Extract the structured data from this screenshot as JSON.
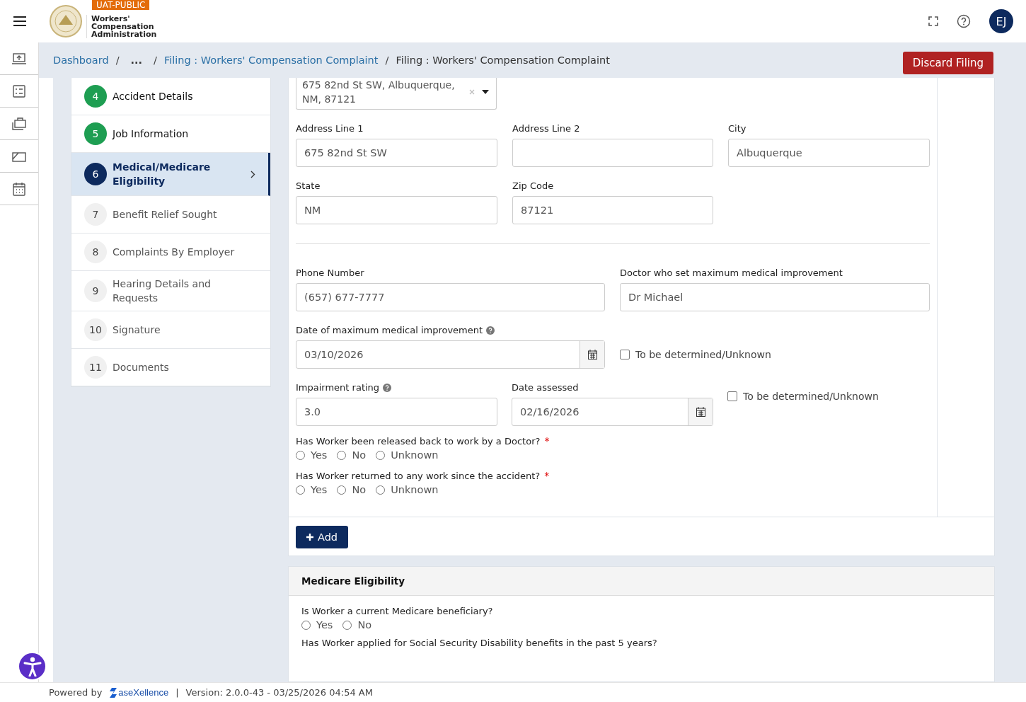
{
  "header": {
    "badge": "UAT-PUBLIC",
    "logo_lines": [
      "Workers'",
      "Compensation",
      "Administration"
    ],
    "avatar": "EJ"
  },
  "breadcrumb": {
    "separators": [
      "/",
      "/",
      "/"
    ],
    "items": [
      {
        "label": "Dashboard",
        "link": true
      },
      {
        "label": "...",
        "link": false
      },
      {
        "label": "Filing : Workers' Compensation Complaint",
        "link": true
      },
      {
        "label": "Filing : Workers' Compensation Complaint",
        "link": false
      }
    ],
    "discard": "Discard Filing"
  },
  "steps": [
    {
      "number": "4",
      "label": "Accident Details",
      "completed": true,
      "selected": false
    },
    {
      "number": "5",
      "label": "Job Information",
      "completed": true,
      "selected": false
    },
    {
      "number": "6",
      "label": "Medical/Medicare Eligibility",
      "completed": false,
      "selected": true
    },
    {
      "number": "7",
      "label": "Benefit Relief Sought",
      "completed": false,
      "selected": false
    },
    {
      "number": "8",
      "label": "Complaints By Employer",
      "completed": false,
      "selected": false
    },
    {
      "number": "9",
      "label": "Hearing Details and Requests",
      "completed": false,
      "selected": false
    },
    {
      "number": "10",
      "label": "Signature",
      "completed": false,
      "selected": false
    },
    {
      "number": "11",
      "label": "Documents",
      "completed": false,
      "selected": false
    }
  ],
  "provider": {
    "address_select": "675 82nd St SW, Albuquerque, NM, 87121",
    "address_rows": [
      [
        {
          "label": "Address Line 1",
          "value": "675 82nd St SW"
        },
        {
          "label": "Address Line 2"
        },
        {
          "label": "City",
          "value": "Albuquerque"
        }
      ],
      [
        {
          "label": "State",
          "value": "NM"
        },
        {
          "label": "Zip Code",
          "value": "87121"
        }
      ]
    ],
    "phone": {
      "label": "Phone Number",
      "value": "(657) 677-7777"
    },
    "doctor": {
      "label": "Doctor who set maximum medical improvement",
      "value": "Dr Michael"
    },
    "mmi_date": {
      "label": "Date of maximum medical improvement",
      "help": true,
      "value": "03/10/2026",
      "unknown_label": "To be determined/Unknown",
      "unknown_checked": false
    },
    "impairment": {
      "label": "Impairment rating",
      "help": true,
      "value": "3.0"
    },
    "date_assessed": {
      "label": "Date assessed",
      "value": "02/16/2026",
      "unknown_label": "To be determined/Unknown",
      "unknown_checked": false
    },
    "questions": [
      {
        "label": "Has Worker been released back to work by a Doctor?",
        "required_mark": "*",
        "options": [
          {
            "label": "Yes",
            "selected": false
          },
          {
            "label": "No",
            "selected": false
          },
          {
            "label": "Unknown",
            "selected": false
          }
        ]
      },
      {
        "label": "Has Worker returned to any work since the accident?",
        "required_mark": "*",
        "options": [
          {
            "label": "Yes",
            "selected": false
          },
          {
            "label": "No",
            "selected": false
          },
          {
            "label": "Unknown",
            "selected": false
          }
        ]
      }
    ],
    "add_button": "Add"
  },
  "medicare": {
    "title": "Medicare Eligibility",
    "questions": [
      {
        "label": "Is Worker a current Medicare beneficiary?",
        "options": [
          {
            "label": "Yes",
            "selected": false
          },
          {
            "label": "No",
            "selected": false
          }
        ]
      },
      {
        "label": "Has Worker applied for Social Security Disability benefits in the past 5 years?"
      }
    ]
  },
  "footer": {
    "powered_by": "Powered by",
    "brand": "aseXellence",
    "separator": "|",
    "version": "Version: 2.0.0-43 - 03/25/2026 04:54 AM"
  }
}
